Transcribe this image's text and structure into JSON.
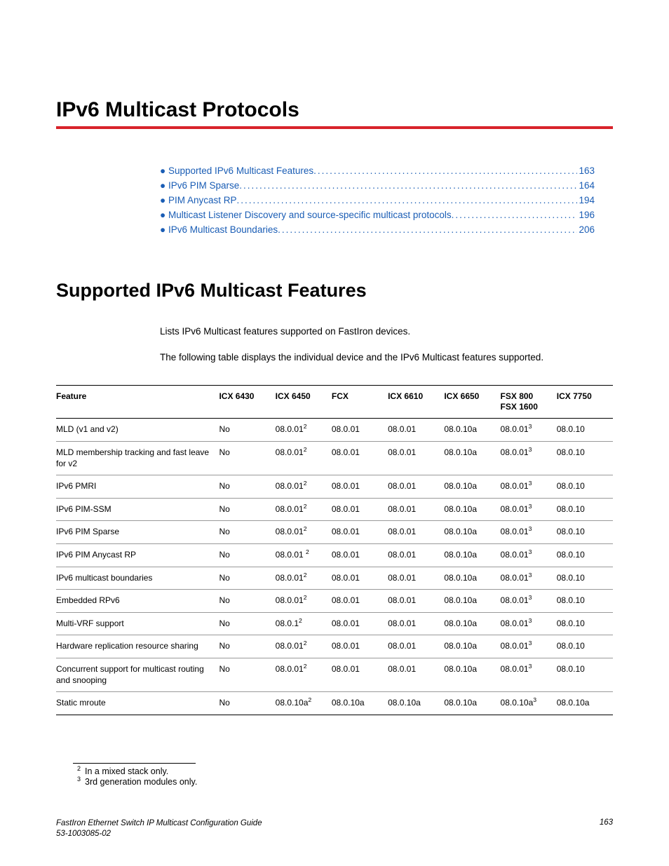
{
  "chapter_title": "IPv6 Multicast Protocols",
  "toc": [
    {
      "label": "Supported IPv6 Multicast Features",
      "page": "163"
    },
    {
      "label": "IPv6 PIM Sparse",
      "page": "164"
    },
    {
      "label": "PIM Anycast RP",
      "page": "194"
    },
    {
      "label": "Multicast Listener Discovery and source-specific multicast protocols",
      "page": "196"
    },
    {
      "label": "IPv6 Multicast Boundaries",
      "page": "206"
    }
  ],
  "section_title": "Supported IPv6 Multicast Features",
  "intro": {
    "p1": "Lists IPv6 Multicast features supported on FastIron devices.",
    "p2": "The following table displays the individual device and the IPv6 Multicast features supported."
  },
  "table": {
    "headers": [
      "Feature",
      "ICX 6430",
      "ICX 6450",
      "FCX",
      "ICX 6610",
      "ICX 6650",
      "FSX 800\nFSX 1600",
      "ICX 7750"
    ],
    "rows": [
      {
        "feature": "MLD (v1 and v2)",
        "cells": [
          "No",
          {
            "v": "08.0.01",
            "s": "2"
          },
          "08.0.01",
          "08.0.01",
          "08.0.10a",
          {
            "v": "08.0.01",
            "s": "3"
          },
          "08.0.10"
        ]
      },
      {
        "feature": "MLD membership tracking and fast leave for v2",
        "cells": [
          "No",
          {
            "v": "08.0.01",
            "s": "2"
          },
          "08.0.01",
          "08.0.01",
          "08.0.10a",
          {
            "v": "08.0.01",
            "s": "3"
          },
          "08.0.10"
        ]
      },
      {
        "feature": "IPv6 PMRI",
        "cells": [
          "No",
          {
            "v": "08.0.01",
            "s": "2"
          },
          "08.0.01",
          "08.0.01",
          "08.0.10a",
          {
            "v": "08.0.01",
            "s": "3"
          },
          "08.0.10"
        ]
      },
      {
        "feature": "IPv6 PIM-SSM",
        "cells": [
          "No",
          {
            "v": "08.0.01",
            "s": "2"
          },
          "08.0.01",
          "08.0.01",
          "08.0.10a",
          {
            "v": "08.0.01",
            "s": "3"
          },
          "08.0.10"
        ]
      },
      {
        "feature": "IPv6 PIM Sparse",
        "cells": [
          "No",
          {
            "v": "08.0.01",
            "s": "2"
          },
          "08.0.01",
          "08.0.01",
          "08.0.10a",
          {
            "v": "08.0.01",
            "s": "3"
          },
          "08.0.10"
        ]
      },
      {
        "feature": "IPv6 PIM Anycast RP",
        "cells": [
          "No",
          {
            "v": "08.0.01 ",
            "s": "2"
          },
          "08.0.01",
          "08.0.01",
          "08.0.10a",
          {
            "v": "08.0.01",
            "s": "3"
          },
          "08.0.10"
        ]
      },
      {
        "feature": "IPv6 multicast boundaries",
        "cells": [
          "No",
          {
            "v": "08.0.01",
            "s": "2"
          },
          "08.0.01",
          "08.0.01",
          "08.0.10a",
          {
            "v": "08.0.01",
            "s": "3"
          },
          "08.0.10"
        ]
      },
      {
        "feature": "Embedded RPv6",
        "cells": [
          "No",
          {
            "v": "08.0.01",
            "s": "2"
          },
          "08.0.01",
          "08.0.01",
          "08.0.10a",
          {
            "v": "08.0.01",
            "s": "3"
          },
          "08.0.10"
        ]
      },
      {
        "feature": "Multi-VRF support",
        "cells": [
          "No",
          {
            "v": "08.0.1",
            "s": "2"
          },
          "08.0.01",
          "08.0.01",
          "08.0.10a",
          {
            "v": "08.0.01",
            "s": "3"
          },
          "08.0.10"
        ]
      },
      {
        "feature": "Hardware replication resource sharing",
        "cells": [
          "No",
          {
            "v": "08.0.01",
            "s": "2"
          },
          "08.0.01",
          "08.0.01",
          "08.0.10a",
          {
            "v": "08.0.01",
            "s": "3"
          },
          "08.0.10"
        ]
      },
      {
        "feature": "Concurrent support for multicast routing and snooping",
        "cells": [
          "No",
          {
            "v": "08.0.01",
            "s": "2"
          },
          "08.0.01",
          "08.0.01",
          "08.0.10a",
          {
            "v": "08.0.01",
            "s": "3"
          },
          "08.0.10"
        ]
      },
      {
        "feature": "Static mroute",
        "cells": [
          "No",
          {
            "v": "08.0.10a",
            "s": "2"
          },
          "08.0.10a",
          "08.0.10a",
          "08.0.10a",
          {
            "v": "08.0.10a",
            "s": "3"
          },
          "08.0.10a"
        ]
      }
    ]
  },
  "footnotes": {
    "2": "In a mixed stack only.",
    "3": "3rd generation modules only."
  },
  "footer": {
    "title": "FastIron Ethernet Switch IP Multicast Configuration Guide",
    "docnum": "53-1003085-02",
    "page": "163"
  }
}
